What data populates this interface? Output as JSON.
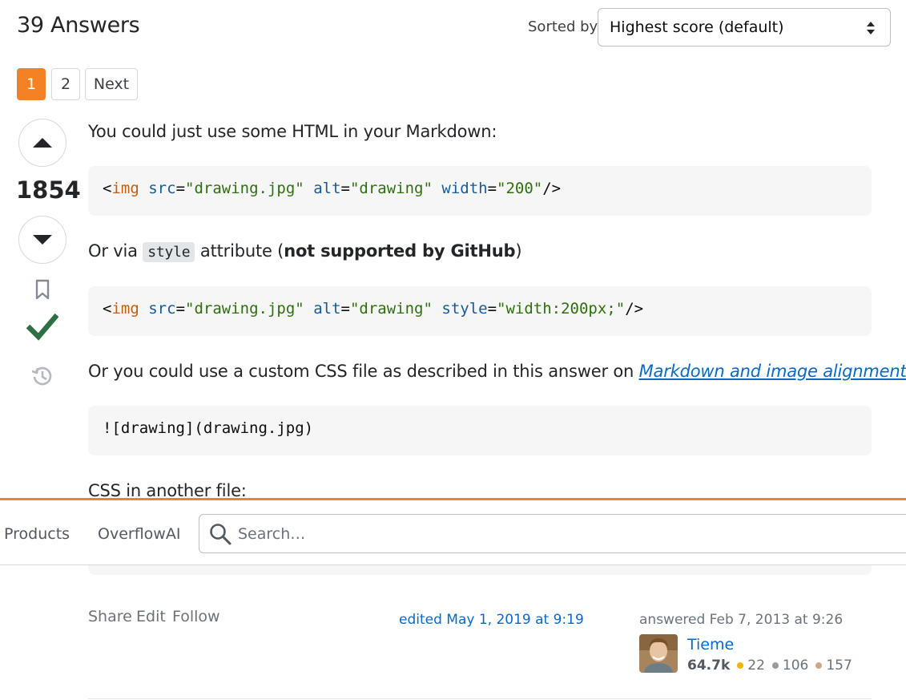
{
  "header": {
    "answers_count": "39 Answers",
    "sorted_label": "Sorted by:",
    "sort_value": "Highest score (default)"
  },
  "pagination": {
    "pages": [
      "1",
      "2"
    ],
    "current": "1",
    "next_label": "Next"
  },
  "answer": {
    "score": "1854",
    "accepted": true,
    "paragraphs": {
      "p1": "You could just use some HTML in your Markdown:",
      "p2_prefix": "Or via ",
      "p2_code": "style",
      "p2_middle": " attribute (",
      "p2_bold": "not supported by GitHub",
      "p2_suffix": ")",
      "p3_prefix": "Or you could use a custom CSS file as described in this answer on ",
      "p3_link": "Markdown and image alignment",
      "p4": "CSS in another file:"
    },
    "code1": {
      "open": "<",
      "tag": "img",
      "attr1": "src",
      "val1": "\"drawing.jpg\"",
      "attr2": "alt",
      "val2": "\"drawing\"",
      "attr3": "width",
      "val3": "\"200\"",
      "close": "/>"
    },
    "code2": {
      "open": "<",
      "tag": "img",
      "attr1": "src",
      "val1": "\"drawing.jpg\"",
      "attr2": "alt",
      "val2": "\"drawing\"",
      "attr3": "style",
      "val3": "\"width:200px;\"",
      "close": "/>"
    },
    "code3": "![drawing](drawing.jpg)"
  },
  "topbar": {
    "products": "Products",
    "overflowai": "OverflowAI",
    "search_placeholder": "Search…"
  },
  "post_menu": {
    "share": "Share",
    "edit": "Edit",
    "follow": "Follow"
  },
  "edited": "edited May 1, 2019 at 9:19",
  "user": {
    "answered": "answered Feb 7, 2013 at 9:26",
    "name": "Tieme",
    "reputation": "64.7k",
    "gold": "22",
    "silver": "106",
    "bronze": "157"
  },
  "colors": {
    "accent": "#f48225",
    "link": "#0a69c7",
    "accepted": "#2f6f44",
    "gold": "#f1b600",
    "silver": "#9a9b9e",
    "bronze": "#d1a684"
  }
}
